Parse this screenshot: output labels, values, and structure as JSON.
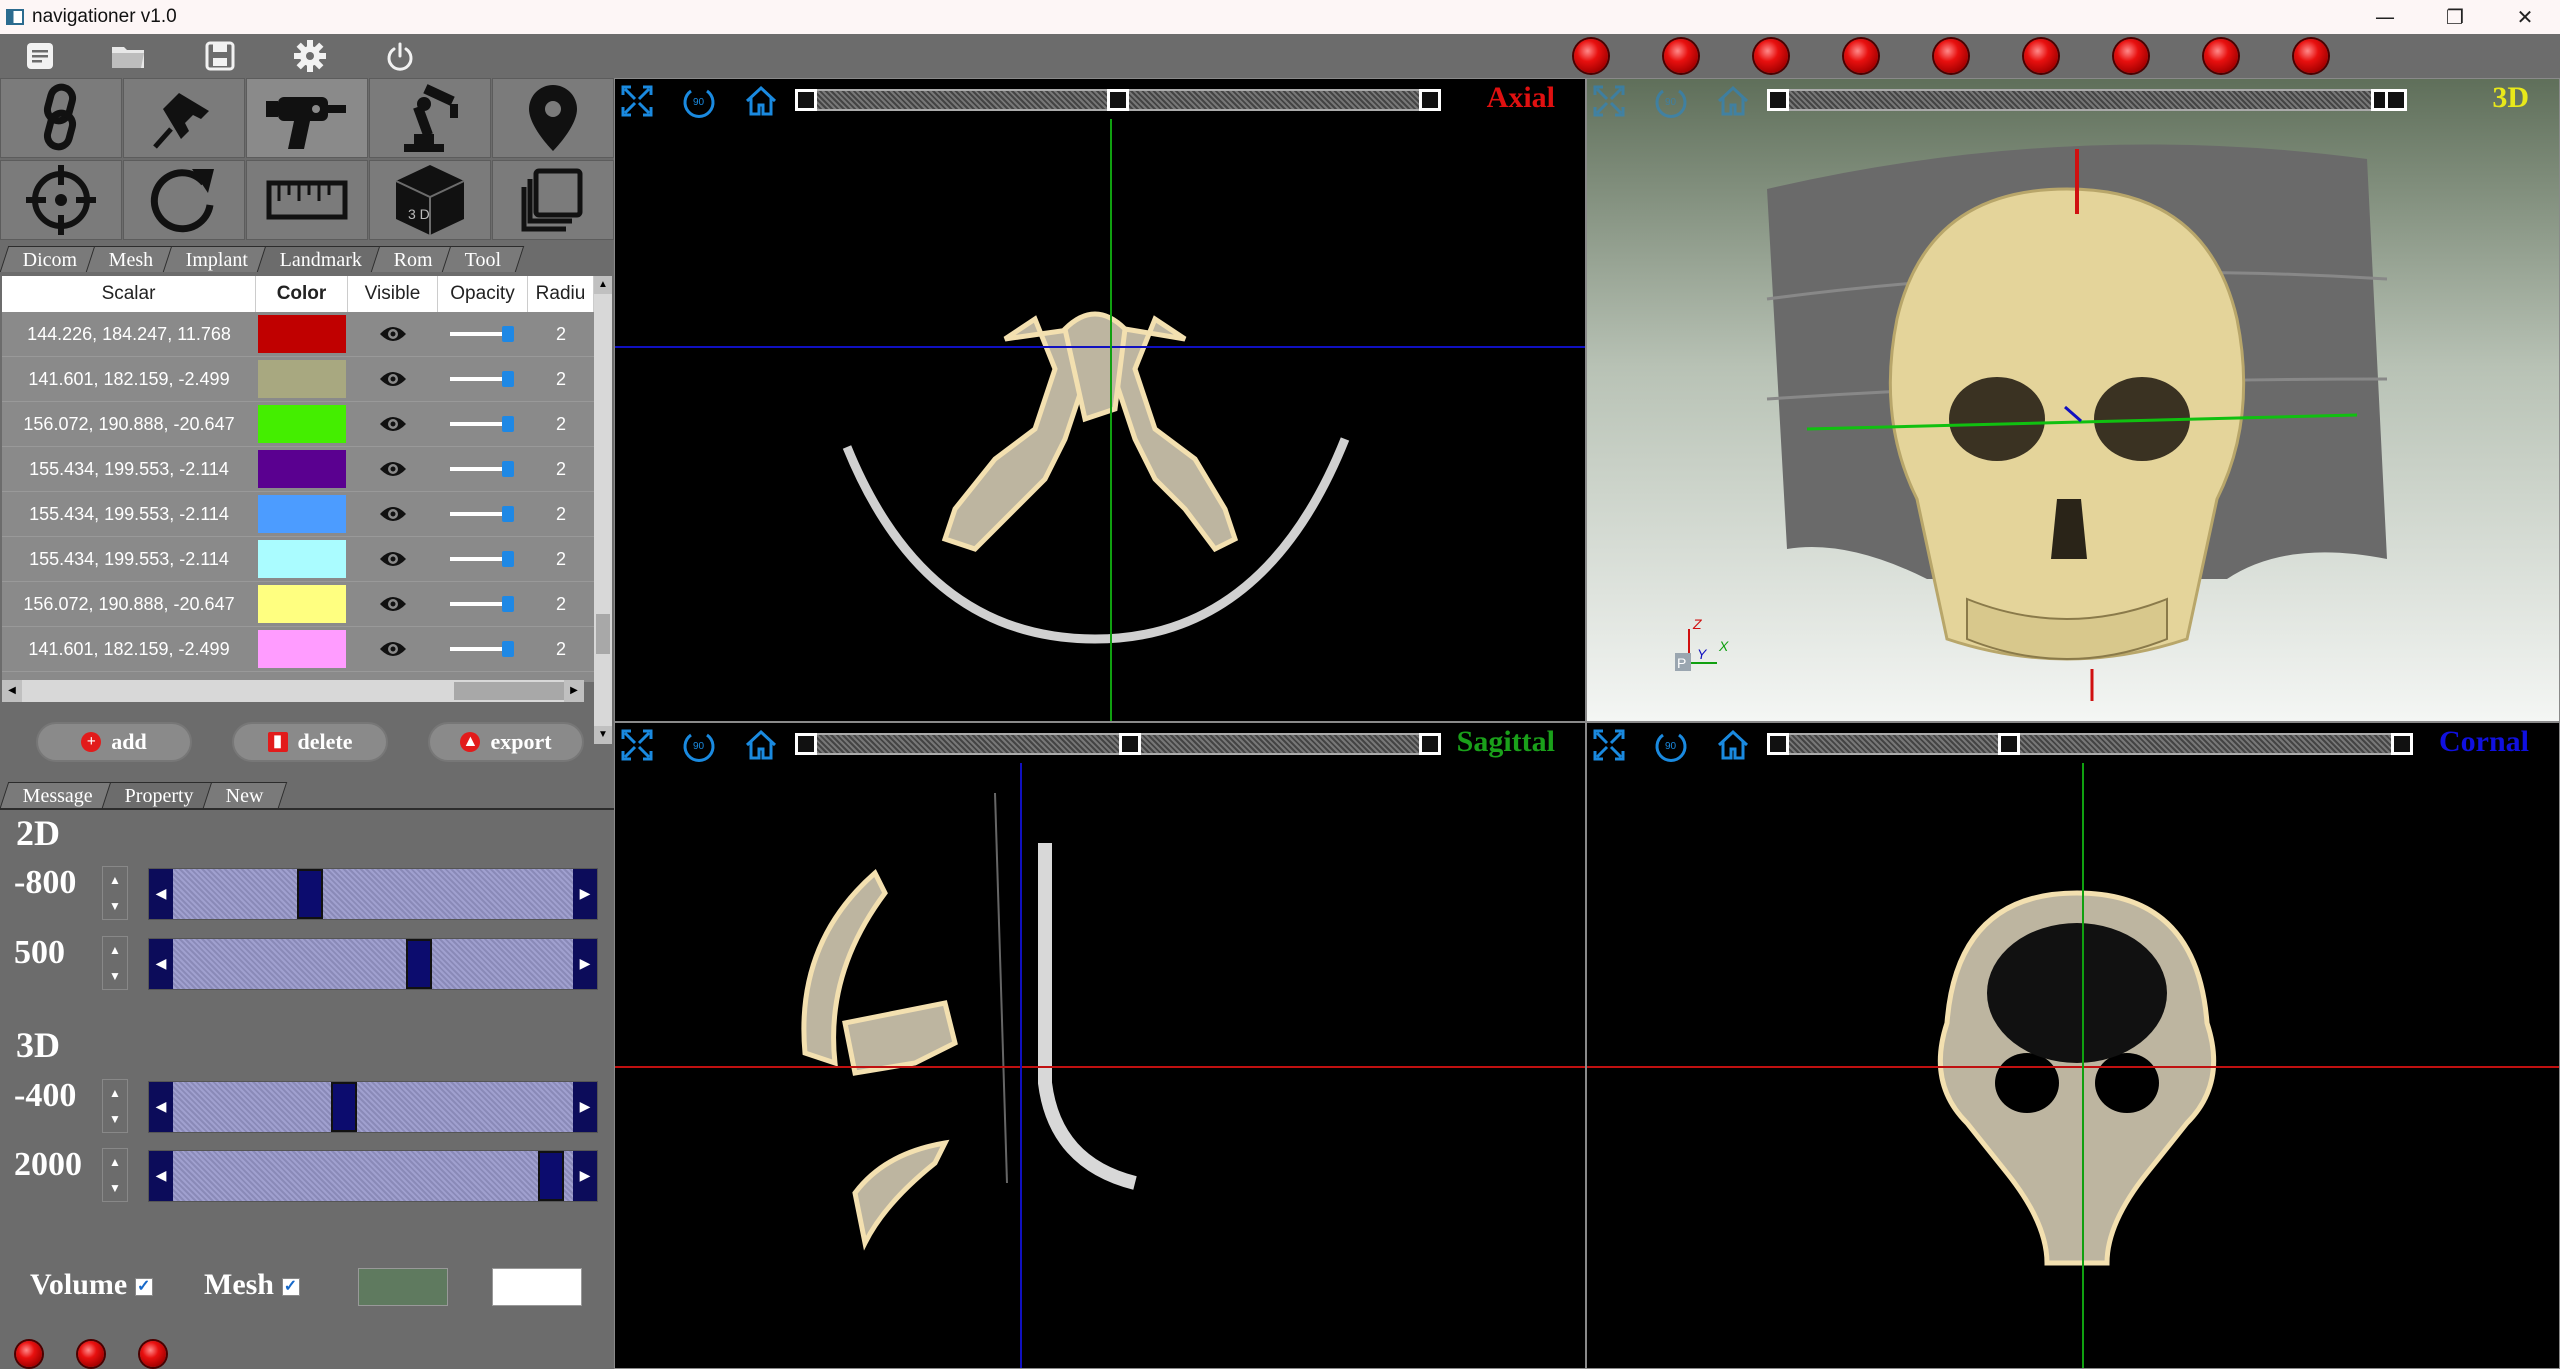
{
  "window": {
    "title": "navigationer v1.0",
    "minimize": "—",
    "restore": "❐",
    "close": "✕"
  },
  "toolbar": {
    "icons": [
      "menu-icon",
      "folder-icon",
      "save-icon",
      "settings-icon",
      "power-icon"
    ],
    "led_count": 9
  },
  "tools": [
    "link-icon",
    "pin-icon",
    "drill-icon",
    "robot-arm-icon",
    "location-pin-icon",
    "target-icon",
    "rotate-icon",
    "ruler-icon",
    "cube-3d-icon",
    "layers-icon"
  ],
  "tools_3d_label": "3 D",
  "module_tabs": [
    "Dicom",
    "Mesh",
    "Implant",
    "Landmark",
    "Rom",
    "Tool"
  ],
  "active_module_tab": "Landmark",
  "landmark_table": {
    "headers": [
      "Scalar",
      "Color",
      "Visible",
      "Opacity",
      "Radiu"
    ],
    "rows": [
      {
        "scalar": "144.226, 184.247, 11.768",
        "color": "#c00000",
        "radius": "2"
      },
      {
        "scalar": "141.601, 182.159, -2.499",
        "color": "#a8a880",
        "radius": "2"
      },
      {
        "scalar": "156.072, 190.888, -20.647",
        "color": "#44ee00",
        "radius": "2"
      },
      {
        "scalar": "155.434, 199.553, -2.114",
        "color": "#5a0090",
        "radius": "2"
      },
      {
        "scalar": "155.434, 199.553, -2.114",
        "color": "#4c9cff",
        "radius": "2"
      },
      {
        "scalar": "155.434, 199.553, -2.114",
        "color": "#aafcff",
        "radius": "2"
      },
      {
        "scalar": "156.072, 190.888, -20.647",
        "color": "#ffff80",
        "radius": "2"
      },
      {
        "scalar": "141.601, 182.159, -2.499",
        "color": "#ff9cff",
        "radius": "2"
      }
    ]
  },
  "actions": {
    "add": "add",
    "delete": "delete",
    "export": "export"
  },
  "bottom_tabs": [
    "Message",
    "Property",
    "New"
  ],
  "active_bottom_tab": "Property",
  "property": {
    "section_2d": "2D",
    "section_3d": "3D",
    "sliders": [
      {
        "value": "-800",
        "level": 0.33
      },
      {
        "value": "500",
        "level": 0.62
      },
      {
        "value": "-400",
        "level": 0.42
      },
      {
        "value": "2000",
        "level": 0.97
      }
    ],
    "volume_label": "Volume",
    "mesh_label": "Mesh",
    "volume_checked": "✓",
    "mesh_checked": "✓",
    "volume_color": "#5f7a5f",
    "mesh_color": "#ffffff"
  },
  "views": {
    "axial": {
      "label": "Axial",
      "color": "#e01010",
      "slice": 0.5
    },
    "view3d": {
      "label": "3D",
      "color": "#e8e81a",
      "slice": 0.98
    },
    "sagittal": {
      "label": "Sagittal",
      "color": "#1aa01a",
      "slice": 0.52
    },
    "coronal": {
      "label": "Cornal",
      "color": "#1010e0",
      "slice": 0.37
    }
  },
  "axes_labels": {
    "z": "Z",
    "y": "Y",
    "x": "X",
    "p": "P"
  }
}
